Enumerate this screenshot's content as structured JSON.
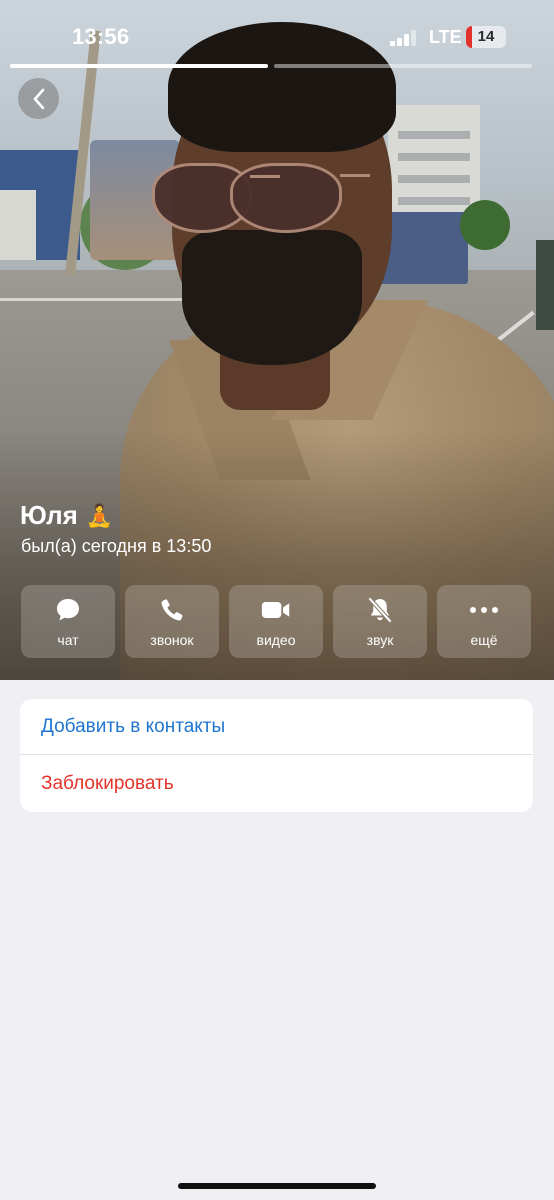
{
  "status_bar": {
    "time": "13:56",
    "network": "LTE",
    "battery_level": "14",
    "battery_fraction": 0.14,
    "battery_color": "#e3322b"
  },
  "profile": {
    "name": "Юля",
    "emoji": "🧘",
    "last_seen": "был(а) сегодня в 13:50"
  },
  "actions": [
    {
      "id": "chat",
      "label": "чат",
      "icon": "chat-bubble-icon"
    },
    {
      "id": "call",
      "label": "звонок",
      "icon": "phone-icon"
    },
    {
      "id": "video",
      "label": "видео",
      "icon": "video-camera-icon"
    },
    {
      "id": "sound",
      "label": "звук",
      "icon": "bell-slash-icon"
    },
    {
      "id": "more",
      "label": "ещё",
      "icon": "ellipsis-icon"
    }
  ],
  "options": {
    "add_contact": "Добавить в контакты",
    "block": "Заблокировать"
  },
  "colors": {
    "link_blue": "#1f75d0",
    "destructive_red": "#e5332a",
    "background": "#efeff4"
  }
}
